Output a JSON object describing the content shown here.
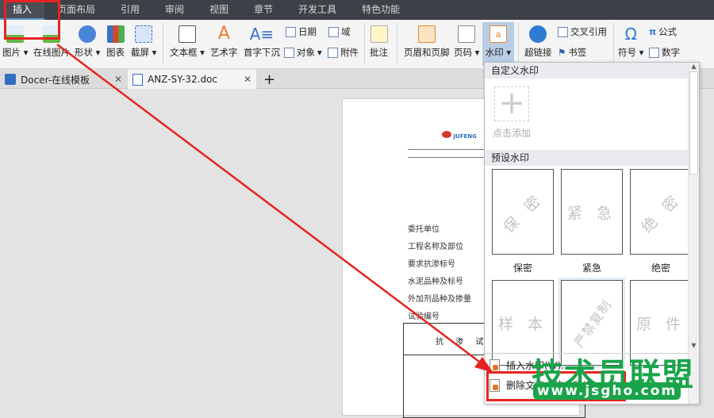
{
  "menu_tabs": [
    "插入",
    "页面布局",
    "引用",
    "审阅",
    "视图",
    "章节",
    "开发工具",
    "特色功能"
  ],
  "ribbon": {
    "picture": "图片",
    "online_picture": "在线图片",
    "shape": "形状",
    "chart": "图表",
    "screenshot": "截屏",
    "textbox": "文本框",
    "wordart": "艺术字",
    "dropcap": "首字下沉",
    "date": "日期",
    "field": "域",
    "object": "对象",
    "attachment": "附件",
    "comment": "批注",
    "header_footer": "页眉和页脚",
    "page_number": "页码",
    "watermark": "水印",
    "hyperlink": "超链接",
    "cross_ref": "交叉引用",
    "bookmark": "书签",
    "symbol": "符号",
    "formula": "公式",
    "number": "数字"
  },
  "doc_tabs": [
    {
      "label": "Docer-在线模板"
    },
    {
      "label": "ANZ-SY-32.doc"
    }
  ],
  "document": {
    "fields": [
      "委托单位",
      "工程名称及部位",
      "要求抗渗标号",
      "水泥品种及标号",
      "外加剂品种及掺量",
      "试验编号"
    ],
    "table_header": "抗 渗 试 验",
    "logo_text": "JUFENG"
  },
  "dropdown": {
    "custom_header": "自定义水印",
    "add_label": "点击添加",
    "preset_header": "预设水印",
    "presets": [
      {
        "text": "保 密",
        "label": "保密"
      },
      {
        "text": "紧 急",
        "label": "紧急"
      },
      {
        "text": "绝 密",
        "label": "绝密"
      },
      {
        "text": "样 本",
        "label": ""
      },
      {
        "text": "严禁复制",
        "label": ""
      },
      {
        "text": "原 件",
        "label": ""
      }
    ],
    "insert": "插入水印(W)...",
    "remove": "删除文档中的水印(R)"
  },
  "site_watermark": {
    "title": "技术员联盟",
    "url": "www.jsgho.com"
  },
  "colors": {
    "highlight": "#e52421",
    "accent": "#1aa44a"
  }
}
